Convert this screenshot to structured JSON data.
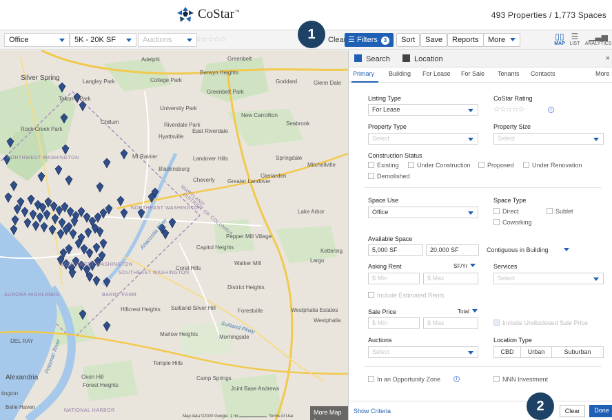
{
  "header": {
    "brand": "CoStar",
    "trademark": "™",
    "count": "493 Properties / 1,773 Spaces"
  },
  "toolbar": {
    "property_type": "Office",
    "size_range": "5K - 20K SF",
    "auctions_placeholder": "Auctions",
    "rating_stars": "☆☆☆☆☆",
    "clear_label": "Clear",
    "filters_label": "Filters",
    "filters_count": "3",
    "sort_label": "Sort",
    "save_label": "Save",
    "reports_label": "Reports",
    "more_label": "More",
    "views": [
      {
        "label": "MAP",
        "icon": "map-icon",
        "active": true
      },
      {
        "label": "LIST",
        "icon": "list-icon",
        "active": false
      },
      {
        "label": "ANALYTICS",
        "icon": "bar-chart-icon",
        "active": false
      }
    ]
  },
  "map": {
    "places": [
      "Adelphi",
      "Greenbelt",
      "Silver Spring",
      "Langley Park",
      "College Park",
      "Berwyn Heights",
      "Goddard",
      "Glenn Dale",
      "Takoma Park",
      "Greenbelt Park",
      "University Park",
      "Riverdale Park",
      "New Carrollton",
      "Seabrook",
      "Chillum",
      "Hyattsville",
      "East Riverdale",
      "Rock Creek Park",
      "Mt Rainier",
      "Landover Hills",
      "Springdale",
      "Mitchellville",
      "NORTHWEST WASHINGTON",
      "Bladensburg",
      "Cheverly",
      "Greater Landover",
      "Glenarden",
      "Lake Arbor",
      "NORTHEAST WASHINGTON",
      "DISTRICT OF COLUMBIA",
      "MARYLAND",
      "Pepper Mill Village",
      "Capitol Heights",
      "Walker Mill",
      "Kettering",
      "Largo",
      "SOUTHWEST WASHINGTON",
      "Coral Hills",
      "SOUTHEAST WASHINGTON",
      "District Heights",
      "BARRY FARM",
      "AURORA HIGHLANDS",
      "Hillcrest Heights",
      "Suitland-Silver Hill",
      "Forestville",
      "Westphalia Estates",
      "Westphalia",
      "Marlow Heights",
      "Morningside",
      "DEL RAY",
      "Temple Hills",
      "Forest Heights",
      "Camp Springs",
      "Joint Base Andrews",
      "Alexandria",
      "Oxon Hill",
      "Belle Haven",
      "NATIONAL HARBOR",
      "Suitland Pkwy",
      "Potomac River",
      "Anacostia River",
      "tington"
    ],
    "attribution": "Map data ©2020 Google",
    "scale": "1 mi",
    "terms": "Terms of Use",
    "more_map": "More Map ›"
  },
  "callouts": {
    "one": "1",
    "two": "2"
  },
  "panel": {
    "tabs": [
      "Search",
      "Location"
    ],
    "close": "×",
    "subtabs": [
      "Primary",
      "Building",
      "For Lease",
      "For Sale",
      "Tenants",
      "Contacts",
      "More"
    ],
    "listing_type": {
      "label": "Listing Type",
      "value": "For Lease"
    },
    "costar_rating": {
      "label": "CoStar Rating",
      "stars": "☆☆☆☆☆",
      "info": "i"
    },
    "property_type": {
      "label": "Property Type",
      "placeholder": "Select"
    },
    "property_size": {
      "label": "Property Size",
      "placeholder": "Select"
    },
    "construction_status": {
      "label": "Construction Status",
      "options": [
        "Existing",
        "Under Construction",
        "Proposed",
        "Under Renovation",
        "Demolished"
      ]
    },
    "space_use": {
      "label": "Space Use",
      "value": "Office"
    },
    "space_type": {
      "label": "Space Type",
      "options": [
        "Direct",
        "Sublet",
        "Coworking"
      ]
    },
    "available_space": {
      "label": "Available Space",
      "min": "5,000 SF",
      "max": "20,000 SF",
      "mode": "Contiguous in Building"
    },
    "asking_rent": {
      "label": "Asking Rent",
      "unit": "SF/Yr",
      "min_placeholder": "$ Min",
      "max_placeholder": "$ Max",
      "estimated": "Include Estimated Rents"
    },
    "services": {
      "label": "Services",
      "placeholder": "Select"
    },
    "sale_price": {
      "label": "Sale Price",
      "unit": "Total",
      "min_placeholder": "$ Min",
      "max_placeholder": "$ Max",
      "undisclosed": "Include Undisclosed Sale Price"
    },
    "auctions": {
      "label": "Auctions",
      "placeholder": "Select"
    },
    "location_type": {
      "label": "Location Type",
      "options": [
        "CBD",
        "Urban",
        "Suburban"
      ]
    },
    "opportunity_zone": "In an Opportunity Zone",
    "nnn": "NNN Investment",
    "show_criteria": "Show Criteria",
    "clear_label": "Clear",
    "done_label": "Done"
  }
}
